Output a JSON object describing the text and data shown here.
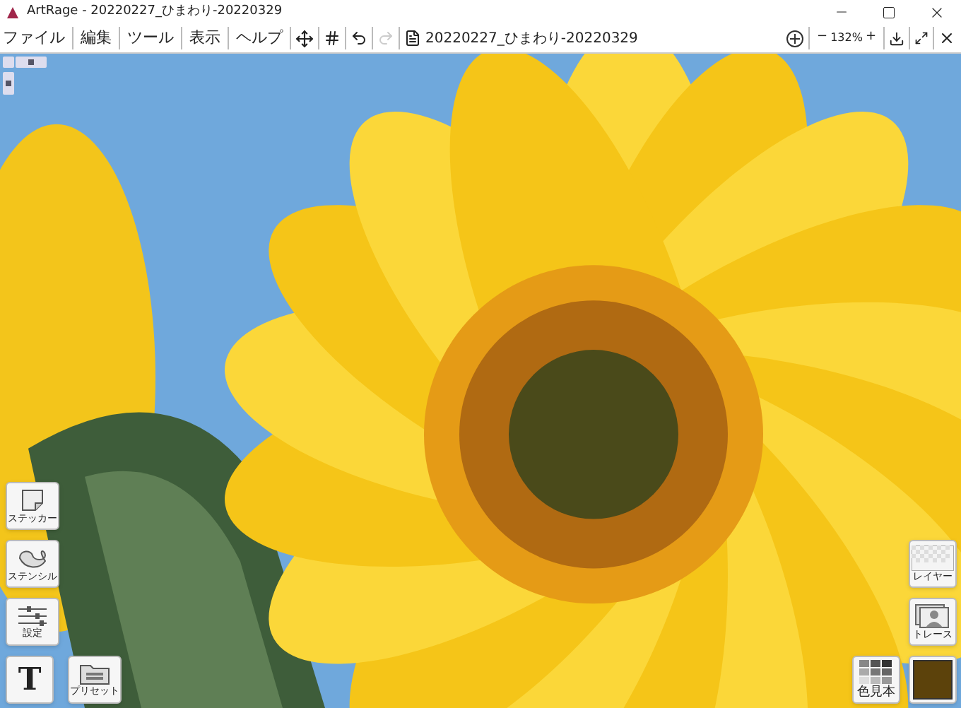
{
  "window": {
    "title": "ArtRage - 20220227_ひまわり-20220329"
  },
  "menu": [
    {
      "label": "ファイル"
    },
    {
      "label": "編集"
    },
    {
      "label": "ツール"
    },
    {
      "label": "表示"
    },
    {
      "label": "ヘルプ"
    }
  ],
  "document": {
    "name": "20220227_ひまわり-20220329"
  },
  "toolbar": {
    "redo_disabled": true,
    "zoom": "132%",
    "zoom_out": "−",
    "zoom_in": "+"
  },
  "canvas": {
    "kind": "picture",
    "zoom_slider": {
      "level": 0.5
    },
    "rotate_slider": {
      "level": 0.5
    }
  },
  "left_tools": [
    {
      "kind": "sticker",
      "label": "ステッカー"
    },
    {
      "kind": "stencil",
      "label": "ステンシル"
    },
    {
      "kind": "settings",
      "label": "設定"
    }
  ],
  "text_tool": {
    "label": "T"
  },
  "presets": {
    "label": "プリセット"
  },
  "right_tools": [
    {
      "kind": "layer",
      "label": "レイヤー"
    },
    {
      "kind": "trace",
      "label": "トレース"
    }
  ],
  "swatches": {
    "label": "色見本"
  },
  "current_color": {
    "color": "#5c420b"
  }
}
